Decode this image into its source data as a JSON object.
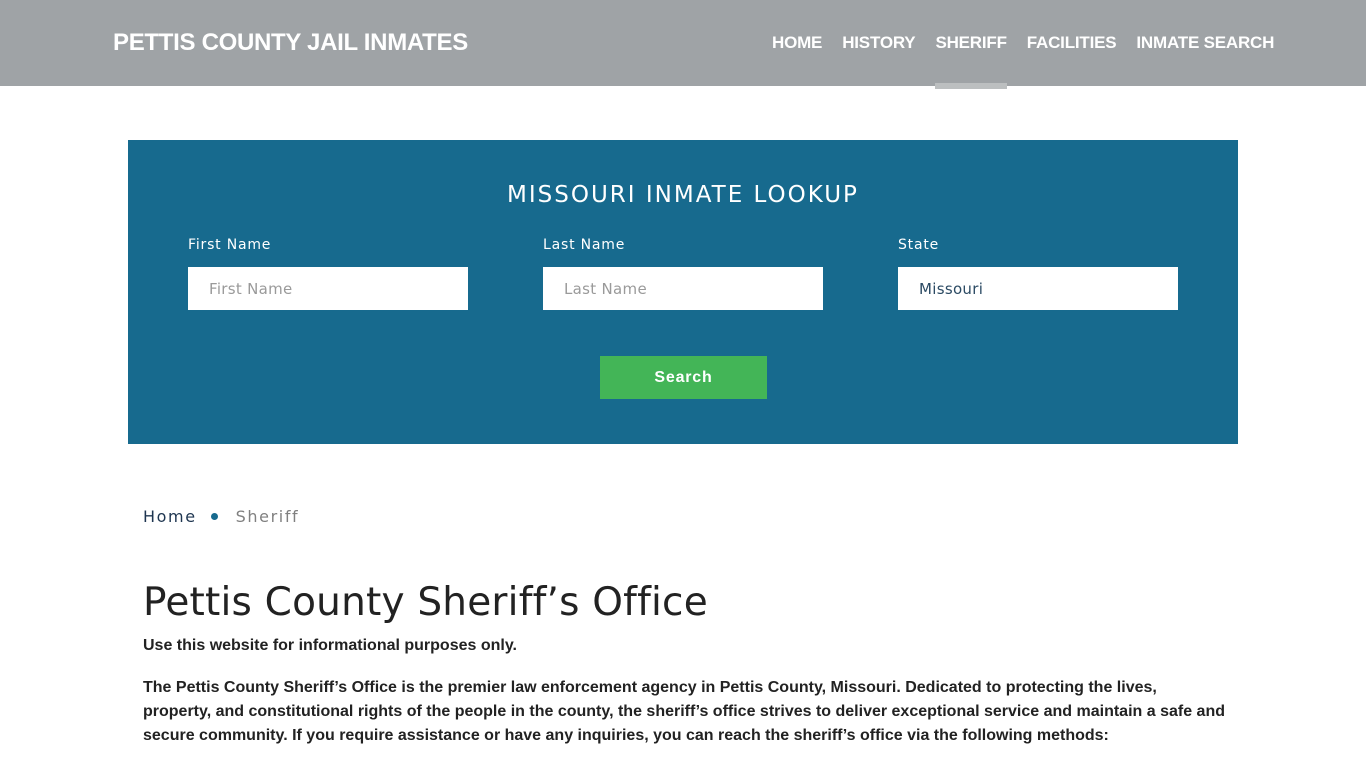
{
  "header": {
    "brand": "PETTIS COUNTY JAIL INMATES",
    "nav": [
      {
        "label": "HOME",
        "active": false
      },
      {
        "label": "HISTORY",
        "active": false
      },
      {
        "label": "SHERIFF",
        "active": true
      },
      {
        "label": "FACILITIES",
        "active": false
      },
      {
        "label": "INMATE SEARCH",
        "active": false
      }
    ]
  },
  "lookup": {
    "title": "MISSOURI INMATE LOOKUP",
    "fields": [
      {
        "label": "First Name",
        "placeholder": "First Name",
        "value": ""
      },
      {
        "label": "Last Name",
        "placeholder": "Last Name",
        "value": ""
      },
      {
        "label": "State",
        "placeholder": "",
        "value": "Missouri"
      }
    ],
    "button": "Search"
  },
  "breadcrumb": {
    "home": "Home",
    "current": "Sheriff"
  },
  "content": {
    "title": "Pettis County Sheriff’s Office",
    "disclaimer": "Use this website for informational purposes only.",
    "intro": "The Pettis County Sheriff’s Office is the premier law enforcement agency in Pettis County, Missouri. Dedicated to protecting the lives, property, and constitutional rights of the people in the county, the sheriff’s office strives to deliver exceptional service and maintain a safe and secure community. If you require assistance or have any inquiries, you can reach the sheriff’s office via the following methods:"
  },
  "colors": {
    "header_bg": "#9fa3a6",
    "panel_bg": "#176a8e",
    "button_bg": "#43b557",
    "active_underline": "#bcbfc0"
  }
}
